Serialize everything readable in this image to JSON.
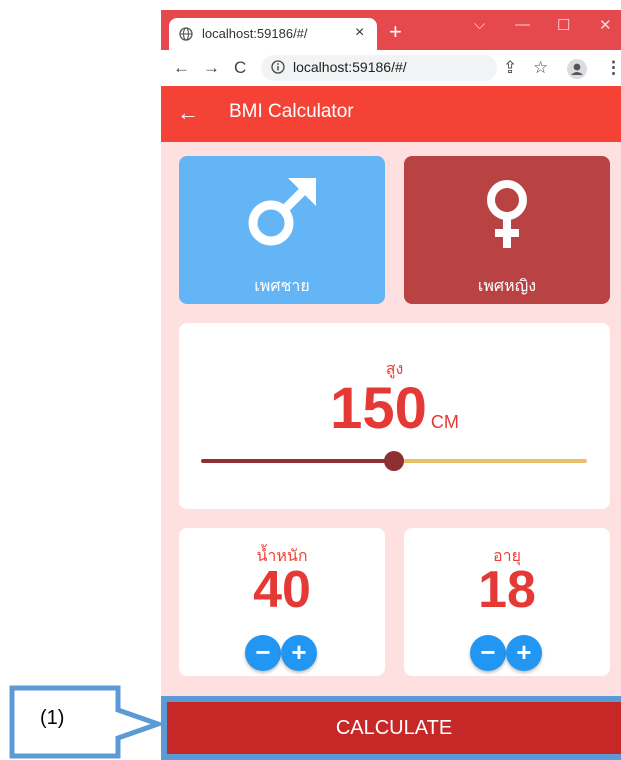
{
  "browser": {
    "tab_title": "localhost:59186/#/",
    "tab_close": "×",
    "new_tab": "+",
    "controls": {
      "chevron": "⌵",
      "minimize": "—",
      "maximize": "☐",
      "close": "✕"
    },
    "nav": {
      "back": "←",
      "forward": "→",
      "reload": "C"
    },
    "url": "localhost:59186/#/",
    "actions": {
      "share": "⇪",
      "star": "☆",
      "profile": "●",
      "menu": "⋮"
    }
  },
  "app": {
    "title": "BMI Calculator",
    "back_icon": "←",
    "gender": {
      "male_label": "เพศชาย",
      "female_label": "เพศหญิง",
      "male_color": "#64b5f6",
      "female_color": "#b94243"
    },
    "height": {
      "label": "สูง",
      "value": "150",
      "unit": "CM",
      "slider_fraction": 0.5,
      "active_color": "#8e2f32",
      "inactive_color": "#e8c06a"
    },
    "weight": {
      "label": "น้ำหนัก",
      "value": "40",
      "minus": "−",
      "plus": "+"
    },
    "age": {
      "label": "อายุ",
      "value": "18",
      "minus": "−",
      "plus": "+"
    },
    "calculate_label": "CALCULATE"
  },
  "annotation": {
    "label": "(1)"
  }
}
